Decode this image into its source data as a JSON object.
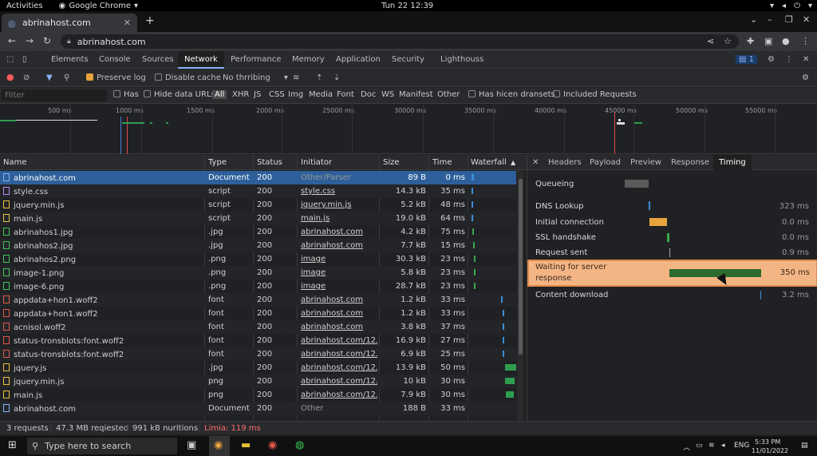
{
  "os": {
    "activities": "Activities",
    "app_name": "Google Chrome",
    "clock": "Tun 22  12:39"
  },
  "browser": {
    "tab_title": "abrinahost.com",
    "url": "abrinahost.com"
  },
  "devtools": {
    "panels": [
      "Elements",
      "Console",
      "Sources",
      "Network",
      "Performance",
      "Memory",
      "Application",
      "Security",
      "Lighthouss"
    ],
    "active_panel": "Network",
    "issues_badge": "1"
  },
  "toolbar": {
    "preserve_log": "Preserve log",
    "disable_cache": "Disable cache",
    "throttling": "No thrribing"
  },
  "filter": {
    "placeholder": "Filter",
    "has": "Has",
    "hide_data_urls": "Hide data URLs",
    "types": [
      "All",
      "XHR",
      "JS",
      "CSS",
      "Img",
      "Media",
      "Font",
      "Doc",
      "WS",
      "Manifest",
      "Other"
    ],
    "has_blocked": "Has hicen dransets",
    "included_requests": "Included Requests"
  },
  "overview_ticks": [
    "500 ms",
    "1000 ms",
    "1500 ms",
    "2000 ms",
    "25000 ms",
    "30000 ms",
    "35000 ms",
    "40000 ms",
    "45000 ms",
    "50000 ms",
    "55000 ms"
  ],
  "table": {
    "headers": [
      "Name",
      "Type",
      "Status",
      "Initiator",
      "Size",
      "Time",
      "Waterfall"
    ],
    "rows": [
      {
        "name": "abrinahost.com",
        "type": "Document",
        "status": "200",
        "initiator": "Other/Parser",
        "size": "89 B",
        "time": "0 ms",
        "icon": "doc-icon"
      },
      {
        "name": "style.css",
        "type": "script",
        "status": "200",
        "initiator": "style.css",
        "size": "14.3 kB",
        "time": "35 ms",
        "icon": "css-icon"
      },
      {
        "name": "jquery.min.js",
        "type": "script",
        "status": "200",
        "initiator": "jquery.min.js",
        "size": "5.2 kB",
        "time": "48 ms",
        "icon": "js-icon"
      },
      {
        "name": "main.js",
        "type": "script",
        "status": "200",
        "initiator": "main.js",
        "size": "19.0 kB",
        "time": "64 ms",
        "icon": "js-icon"
      },
      {
        "name": "abrinahos1.jpg",
        "type": ".jpg",
        "status": "200",
        "initiator": "abrinahost.com",
        "size": "4.2 kB",
        "time": "75 ms",
        "icon": "img-icon"
      },
      {
        "name": "abrinahos2.jpg",
        "type": ".jpg",
        "status": "200",
        "initiator": "abrinahost.com",
        "size": "7.7 kB",
        "time": "15 ms",
        "icon": "img-icon"
      },
      {
        "name": "abrinahos2.png",
        "type": ".png",
        "status": "200",
        "initiator": "image",
        "size": "30.3 kB",
        "time": "23 ms",
        "icon": "img-icon"
      },
      {
        "name": "image-1.png",
        "type": ".png",
        "status": "200",
        "initiator": "image",
        "size": "5.8 kB",
        "time": "23 ms",
        "icon": "img-icon"
      },
      {
        "name": "image-6.png",
        "type": ".png",
        "status": "200",
        "initiator": "image",
        "size": "28.7 kB",
        "time": "23 ms",
        "icon": "img-icon"
      },
      {
        "name": "appdata+hon1.woff2",
        "type": "font",
        "status": "200",
        "initiator": "abrinahost.com",
        "size": "1.2 kB",
        "time": "33 ms",
        "icon": "font-icon"
      },
      {
        "name": "appdata+hon1.woff2",
        "type": "font",
        "status": "200",
        "initiator": "abrinahost.com",
        "size": "1.2 kB",
        "time": "33 ms",
        "icon": "font-icon"
      },
      {
        "name": "acnisol.woff2",
        "type": "font",
        "status": "200",
        "initiator": "abrinahost.com",
        "size": "3.8 kB",
        "time": "37 ms",
        "icon": "font-icon"
      },
      {
        "name": "status-tronsblots:font.woff2",
        "type": "font",
        "status": "200",
        "initiator": "abrinahost.com/12...",
        "size": "16.9 kB",
        "time": "27 ms",
        "icon": "font-icon"
      },
      {
        "name": "status-tronsblots:font.woff2",
        "type": "font",
        "status": "200",
        "initiator": "abrinahost.com/12...",
        "size": "6.9 kB",
        "time": "25 ms",
        "icon": "font-icon"
      },
      {
        "name": "jquery.js",
        "type": ".jpg",
        "status": "200",
        "initiator": "abrinahost.com/12...",
        "size": "13.9 kB",
        "time": "50 ms",
        "icon": "js-icon"
      },
      {
        "name": "jquery.min.js",
        "type": "png",
        "status": "200",
        "initiator": "abrinahost.com/12...",
        "size": "10 kB",
        "time": "30 ms",
        "icon": "js-icon"
      },
      {
        "name": "main.js",
        "type": "png",
        "status": "200",
        "initiator": "abrinahost.com/12...",
        "size": "7.9 kB",
        "time": "30 ms",
        "icon": "js-icon"
      },
      {
        "name": "abrinahost.com",
        "type": "Document",
        "status": "200",
        "initiator": "Other",
        "size": "188 B",
        "time": "33 ms",
        "icon": "doc-icon"
      }
    ]
  },
  "details": {
    "tabs": [
      "Headers",
      "Payload",
      "Preview",
      "Response",
      "Timing"
    ],
    "active_tab": "Timing",
    "timing": [
      {
        "label": "Queueing",
        "value": ""
      },
      {
        "label": "DNS Lookup",
        "value": "323 ms"
      },
      {
        "label": "Initial connection",
        "value": "0.0 ms"
      },
      {
        "label": "SSL handshake",
        "value": "0.0 ms"
      },
      {
        "label": "Request sent",
        "value": "0.9 ms"
      },
      {
        "label_line1": "Waiting for server",
        "label_line2": "response",
        "value": "350 ms"
      },
      {
        "label": "Content download",
        "value": "3.2 ms"
      }
    ]
  },
  "status": {
    "requests": "3 requests",
    "transferred": "47.3 MB reqiested",
    "resources": "991 kB nuritions",
    "finish": "Limia: 119 ms"
  },
  "taskbar": {
    "search_placeholder": "Type here to search",
    "lang": "ENG",
    "time": "5:33 PM",
    "date": "11/01/2022"
  },
  "colors": {
    "accent": "#8ab4f8",
    "selected_row": "#2d5f9a",
    "waiting_highlight": "#f4b585",
    "waiting_bar": "#2e6b2e",
    "connection_bar": "#e8a33c",
    "error_text": "#ff6b6b"
  }
}
